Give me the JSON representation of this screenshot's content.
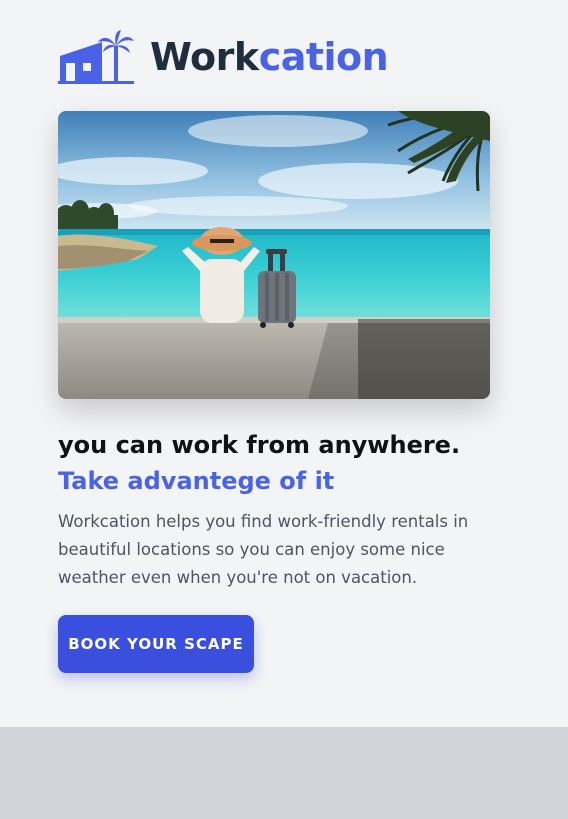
{
  "brand": {
    "name_part1": "Work",
    "name_part2": "cation",
    "logo_icon": "beach-house-palm-icon",
    "dark_color": "#1f2d3d",
    "accent_color": "#4a63e6"
  },
  "hero": {
    "image": "woman-with-suitcase-at-beach-photo"
  },
  "content": {
    "headline": "you can work from anywhere.",
    "headline_accent": "Take advantege of it",
    "description": "Workcation helps you find work-friendly rentals in beautiful locations so you can enjoy some nice weather even when you're not on vacation."
  },
  "cta": {
    "label": "BOOK YOUR SCAPE",
    "color": "#3b4fdf"
  }
}
